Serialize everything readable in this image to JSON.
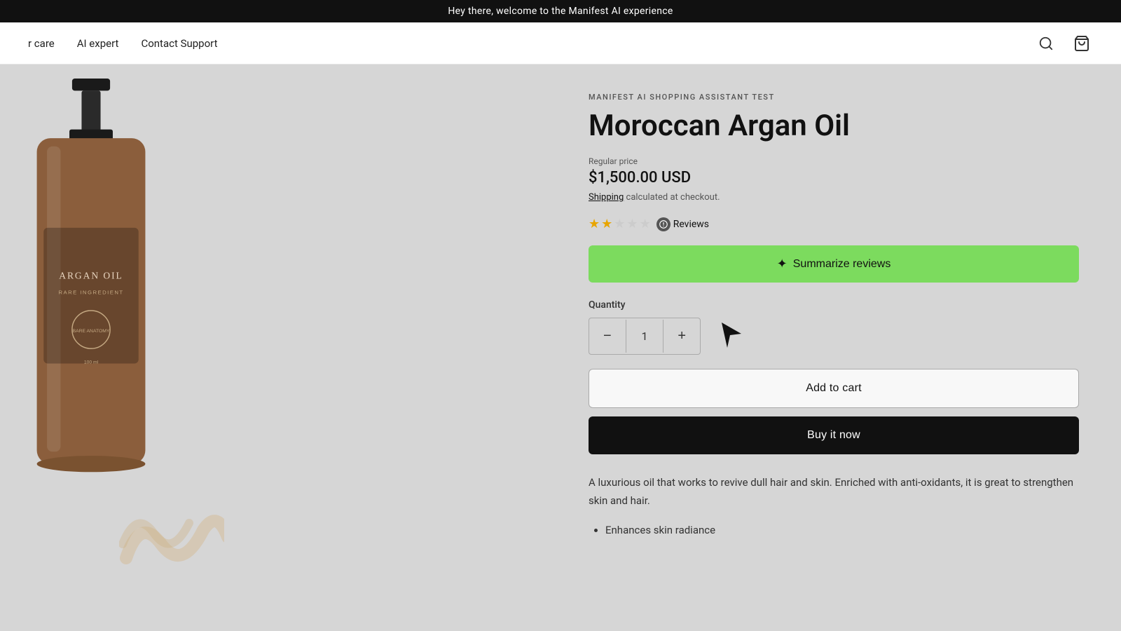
{
  "announcement": {
    "text": "Hey there, welcome to the Manifest AI experience"
  },
  "nav": {
    "items": [
      {
        "label": "r care",
        "id": "nav-care"
      },
      {
        "label": "AI expert",
        "id": "nav-ai-expert"
      },
      {
        "label": "Contact Support",
        "id": "nav-contact-support"
      }
    ],
    "search_icon": "🔍",
    "cart_icon": "🛒"
  },
  "product": {
    "brand": "MANIFEST AI SHOPPING ASSISTANT TEST",
    "title": "Moroccan Argan Oil",
    "price_label": "Regular price",
    "price": "$1,500.00 USD",
    "shipping_text": "calculated at checkout.",
    "shipping_link": "Shipping",
    "rating": {
      "filled": 2,
      "empty": 3,
      "total": 5,
      "reviews_label": "Reviews"
    },
    "summarize_btn_label": "Summarize reviews",
    "quantity_label": "Quantity",
    "quantity_value": "1",
    "add_to_cart_label": "Add to cart",
    "buy_now_label": "Buy it now",
    "description": "A luxurious oil that works to revive dull hair and skin. Enriched with anti-oxidants, it is great to strengthen skin and hair.",
    "bullets": [
      "Enhances skin radiance"
    ]
  },
  "bottle": {
    "label_text": "ARGAN OIL",
    "sublabel": "RARE INGREDIENT"
  },
  "colors": {
    "summarize_bg": "#7cdb5e",
    "announcement_bg": "#111111",
    "buy_now_bg": "#111111",
    "star_filled": "#e8a500",
    "star_empty": "#cccccc"
  }
}
